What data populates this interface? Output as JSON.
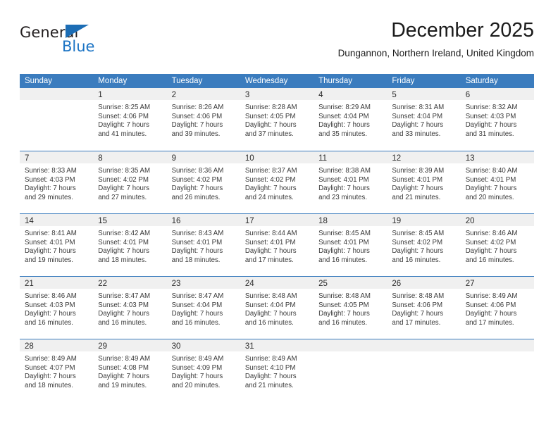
{
  "brand": {
    "name_top": "General",
    "name_bottom": "Blue",
    "logo_icon": "blue-triangle-icon",
    "color_dark": "#231f20",
    "color_blue": "#1a73c4"
  },
  "header": {
    "title": "December 2025",
    "subtitle": "Dungannon, Northern Ireland, United Kingdom"
  },
  "theme": {
    "header_blue": "#3b7cbe",
    "daynum_band": "#f0f0f0",
    "text": "#3a3a3a"
  },
  "calendar": {
    "weekdays": [
      "Sunday",
      "Monday",
      "Tuesday",
      "Wednesday",
      "Thursday",
      "Friday",
      "Saturday"
    ],
    "weeks": [
      [
        {
          "day": "",
          "sunrise": "",
          "sunset": "",
          "daylight_line1": "",
          "daylight_line2": ""
        },
        {
          "day": "1",
          "sunrise": "Sunrise: 8:25 AM",
          "sunset": "Sunset: 4:06 PM",
          "daylight_line1": "Daylight: 7 hours",
          "daylight_line2": "and 41 minutes."
        },
        {
          "day": "2",
          "sunrise": "Sunrise: 8:26 AM",
          "sunset": "Sunset: 4:06 PM",
          "daylight_line1": "Daylight: 7 hours",
          "daylight_line2": "and 39 minutes."
        },
        {
          "day": "3",
          "sunrise": "Sunrise: 8:28 AM",
          "sunset": "Sunset: 4:05 PM",
          "daylight_line1": "Daylight: 7 hours",
          "daylight_line2": "and 37 minutes."
        },
        {
          "day": "4",
          "sunrise": "Sunrise: 8:29 AM",
          "sunset": "Sunset: 4:04 PM",
          "daylight_line1": "Daylight: 7 hours",
          "daylight_line2": "and 35 minutes."
        },
        {
          "day": "5",
          "sunrise": "Sunrise: 8:31 AM",
          "sunset": "Sunset: 4:04 PM",
          "daylight_line1": "Daylight: 7 hours",
          "daylight_line2": "and 33 minutes."
        },
        {
          "day": "6",
          "sunrise": "Sunrise: 8:32 AM",
          "sunset": "Sunset: 4:03 PM",
          "daylight_line1": "Daylight: 7 hours",
          "daylight_line2": "and 31 minutes."
        }
      ],
      [
        {
          "day": "7",
          "sunrise": "Sunrise: 8:33 AM",
          "sunset": "Sunset: 4:03 PM",
          "daylight_line1": "Daylight: 7 hours",
          "daylight_line2": "and 29 minutes."
        },
        {
          "day": "8",
          "sunrise": "Sunrise: 8:35 AM",
          "sunset": "Sunset: 4:02 PM",
          "daylight_line1": "Daylight: 7 hours",
          "daylight_line2": "and 27 minutes."
        },
        {
          "day": "9",
          "sunrise": "Sunrise: 8:36 AM",
          "sunset": "Sunset: 4:02 PM",
          "daylight_line1": "Daylight: 7 hours",
          "daylight_line2": "and 26 minutes."
        },
        {
          "day": "10",
          "sunrise": "Sunrise: 8:37 AM",
          "sunset": "Sunset: 4:02 PM",
          "daylight_line1": "Daylight: 7 hours",
          "daylight_line2": "and 24 minutes."
        },
        {
          "day": "11",
          "sunrise": "Sunrise: 8:38 AM",
          "sunset": "Sunset: 4:01 PM",
          "daylight_line1": "Daylight: 7 hours",
          "daylight_line2": "and 23 minutes."
        },
        {
          "day": "12",
          "sunrise": "Sunrise: 8:39 AM",
          "sunset": "Sunset: 4:01 PM",
          "daylight_line1": "Daylight: 7 hours",
          "daylight_line2": "and 21 minutes."
        },
        {
          "day": "13",
          "sunrise": "Sunrise: 8:40 AM",
          "sunset": "Sunset: 4:01 PM",
          "daylight_line1": "Daylight: 7 hours",
          "daylight_line2": "and 20 minutes."
        }
      ],
      [
        {
          "day": "14",
          "sunrise": "Sunrise: 8:41 AM",
          "sunset": "Sunset: 4:01 PM",
          "daylight_line1": "Daylight: 7 hours",
          "daylight_line2": "and 19 minutes."
        },
        {
          "day": "15",
          "sunrise": "Sunrise: 8:42 AM",
          "sunset": "Sunset: 4:01 PM",
          "daylight_line1": "Daylight: 7 hours",
          "daylight_line2": "and 18 minutes."
        },
        {
          "day": "16",
          "sunrise": "Sunrise: 8:43 AM",
          "sunset": "Sunset: 4:01 PM",
          "daylight_line1": "Daylight: 7 hours",
          "daylight_line2": "and 18 minutes."
        },
        {
          "day": "17",
          "sunrise": "Sunrise: 8:44 AM",
          "sunset": "Sunset: 4:01 PM",
          "daylight_line1": "Daylight: 7 hours",
          "daylight_line2": "and 17 minutes."
        },
        {
          "day": "18",
          "sunrise": "Sunrise: 8:45 AM",
          "sunset": "Sunset: 4:01 PM",
          "daylight_line1": "Daylight: 7 hours",
          "daylight_line2": "and 16 minutes."
        },
        {
          "day": "19",
          "sunrise": "Sunrise: 8:45 AM",
          "sunset": "Sunset: 4:02 PM",
          "daylight_line1": "Daylight: 7 hours",
          "daylight_line2": "and 16 minutes."
        },
        {
          "day": "20",
          "sunrise": "Sunrise: 8:46 AM",
          "sunset": "Sunset: 4:02 PM",
          "daylight_line1": "Daylight: 7 hours",
          "daylight_line2": "and 16 minutes."
        }
      ],
      [
        {
          "day": "21",
          "sunrise": "Sunrise: 8:46 AM",
          "sunset": "Sunset: 4:03 PM",
          "daylight_line1": "Daylight: 7 hours",
          "daylight_line2": "and 16 minutes."
        },
        {
          "day": "22",
          "sunrise": "Sunrise: 8:47 AM",
          "sunset": "Sunset: 4:03 PM",
          "daylight_line1": "Daylight: 7 hours",
          "daylight_line2": "and 16 minutes."
        },
        {
          "day": "23",
          "sunrise": "Sunrise: 8:47 AM",
          "sunset": "Sunset: 4:04 PM",
          "daylight_line1": "Daylight: 7 hours",
          "daylight_line2": "and 16 minutes."
        },
        {
          "day": "24",
          "sunrise": "Sunrise: 8:48 AM",
          "sunset": "Sunset: 4:04 PM",
          "daylight_line1": "Daylight: 7 hours",
          "daylight_line2": "and 16 minutes."
        },
        {
          "day": "25",
          "sunrise": "Sunrise: 8:48 AM",
          "sunset": "Sunset: 4:05 PM",
          "daylight_line1": "Daylight: 7 hours",
          "daylight_line2": "and 16 minutes."
        },
        {
          "day": "26",
          "sunrise": "Sunrise: 8:48 AM",
          "sunset": "Sunset: 4:06 PM",
          "daylight_line1": "Daylight: 7 hours",
          "daylight_line2": "and 17 minutes."
        },
        {
          "day": "27",
          "sunrise": "Sunrise: 8:49 AM",
          "sunset": "Sunset: 4:06 PM",
          "daylight_line1": "Daylight: 7 hours",
          "daylight_line2": "and 17 minutes."
        }
      ],
      [
        {
          "day": "28",
          "sunrise": "Sunrise: 8:49 AM",
          "sunset": "Sunset: 4:07 PM",
          "daylight_line1": "Daylight: 7 hours",
          "daylight_line2": "and 18 minutes."
        },
        {
          "day": "29",
          "sunrise": "Sunrise: 8:49 AM",
          "sunset": "Sunset: 4:08 PM",
          "daylight_line1": "Daylight: 7 hours",
          "daylight_line2": "and 19 minutes."
        },
        {
          "day": "30",
          "sunrise": "Sunrise: 8:49 AM",
          "sunset": "Sunset: 4:09 PM",
          "daylight_line1": "Daylight: 7 hours",
          "daylight_line2": "and 20 minutes."
        },
        {
          "day": "31",
          "sunrise": "Sunrise: 8:49 AM",
          "sunset": "Sunset: 4:10 PM",
          "daylight_line1": "Daylight: 7 hours",
          "daylight_line2": "and 21 minutes."
        },
        {
          "day": "",
          "sunrise": "",
          "sunset": "",
          "daylight_line1": "",
          "daylight_line2": ""
        },
        {
          "day": "",
          "sunrise": "",
          "sunset": "",
          "daylight_line1": "",
          "daylight_line2": ""
        },
        {
          "day": "",
          "sunrise": "",
          "sunset": "",
          "daylight_line1": "",
          "daylight_line2": ""
        }
      ]
    ]
  }
}
